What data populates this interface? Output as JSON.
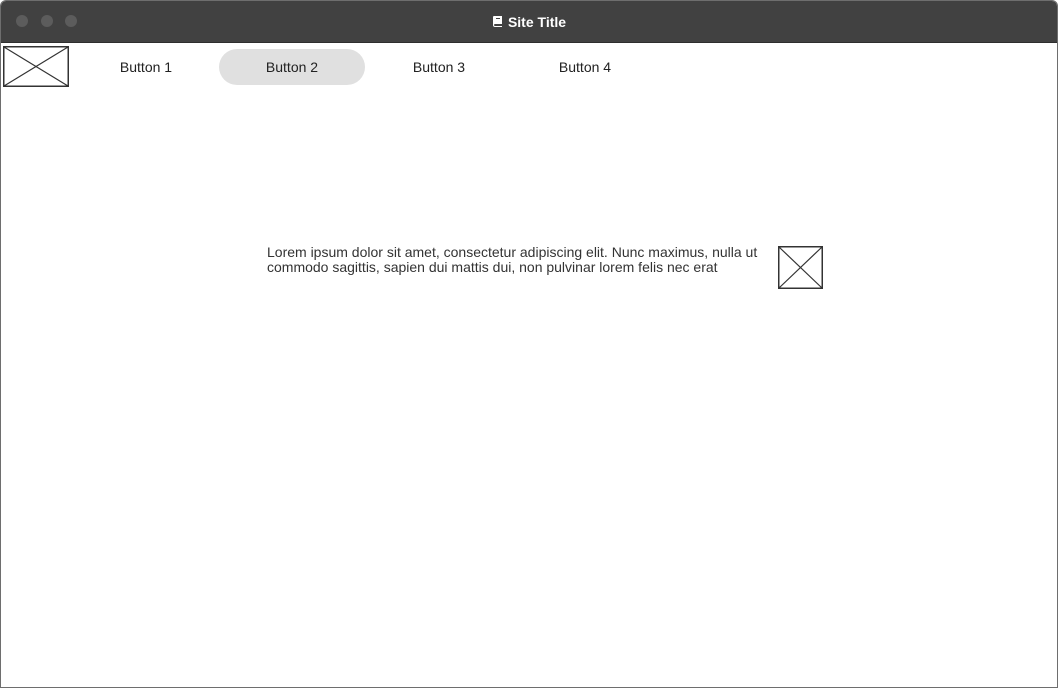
{
  "window": {
    "title": "Site Title",
    "title_icon": "book-icon",
    "controls": [
      "close",
      "minimize",
      "maximize"
    ]
  },
  "nav": {
    "logo": "image-placeholder-icon",
    "buttons": [
      {
        "label": "Button 1",
        "active": false
      },
      {
        "label": "Button 2",
        "active": true
      },
      {
        "label": "Button 3",
        "active": false
      },
      {
        "label": "Button 4",
        "active": false
      }
    ]
  },
  "main": {
    "text": "Lorem ipsum dolor sit amet, consectetur adipiscing elit. Nunc maximus, nulla ut commodo sagittis, sapien dui mattis dui, non pulvinar lorem felis nec erat",
    "image": "image-placeholder-icon"
  },
  "colors": {
    "titlebar": "#414141",
    "active_button": "#e0e0e0",
    "window_control": "#5c5c5c"
  }
}
